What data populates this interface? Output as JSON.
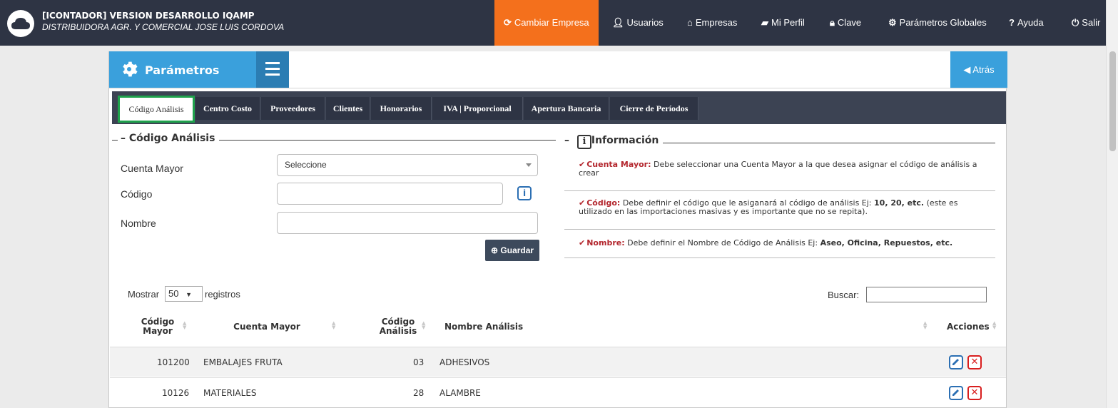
{
  "header": {
    "brand_title": "[ICONTADOR] VERSION DESARROLLO IQAMP",
    "brand_subtitle": "DISTRIBUIDORA AGR. Y COMERCIAL JOSE LUIS CORDOVA",
    "nav": [
      {
        "label": "Cambiar Empresa",
        "icon": "refresh-icon"
      },
      {
        "label": "Usuarios",
        "icon": "user-icon"
      },
      {
        "label": "Empresas",
        "icon": "home-icon"
      },
      {
        "label": "Mi Perfil",
        "icon": "folder-icon"
      },
      {
        "label": "Clave",
        "icon": "lock-icon"
      },
      {
        "label": "Parámetros Globales",
        "icon": "gear-icon"
      },
      {
        "label": "Ayuda",
        "icon": "question-icon"
      },
      {
        "label": "Salir",
        "icon": "power-icon"
      }
    ],
    "accent": "#f4701c",
    "bg": "#2e3444"
  },
  "panel": {
    "title": "Parámetros",
    "back_label": "Atrás"
  },
  "tabs": [
    "Código Análisis",
    "Centro Costo",
    "Proveedores",
    "Clientes",
    "Honorarios",
    "IVA | Proporcional",
    "Apertura Bancaria",
    "Cierre de Períodos"
  ],
  "form": {
    "legend": "Código Análisis",
    "cuenta_label": "Cuenta Mayor",
    "cuenta_value": "Seleccione",
    "codigo_label": "Código",
    "codigo_value": "",
    "nombre_label": "Nombre",
    "nombre_value": "",
    "save_label": "Guardar"
  },
  "info": {
    "legend": "Información",
    "items": [
      {
        "key": "Cuenta Mayor:",
        "text": "Debe seleccionar una Cuenta Mayor a la que desea asignar el código de análisis a crear"
      },
      {
        "key": "Código:",
        "text_a": "Debe definir el código que le asiganará al código de análisis Ej:",
        "bold": "10, 20, etc.",
        "text_b": "(este es utilizado en las importaciones masivas y es importante que no se repita)."
      },
      {
        "key": "Nombre:",
        "text_a": "Debe definir el Nombre de Código de Análisis Ej:",
        "bold": "Aseo, Oficina, Repuestos, etc."
      }
    ]
  },
  "table": {
    "show_prefix": "Mostrar",
    "show_value": "50",
    "show_suffix": "registros",
    "search_label": "Buscar:",
    "search_value": "",
    "headers": {
      "codigo_mayor_1": "Código",
      "codigo_mayor_2": "Mayor",
      "cuenta_mayor": "Cuenta Mayor",
      "codigo_analisis_1": "Código",
      "codigo_analisis_2": "Análisis",
      "nombre_analisis": "Nombre Análisis",
      "acciones": "Acciones"
    },
    "rows": [
      {
        "codigo_mayor": "101200",
        "cuenta_mayor": "EMBALAJES FRUTA",
        "codigo_analisis": "03",
        "nombre": "ADHESIVOS"
      },
      {
        "codigo_mayor": "10126",
        "cuenta_mayor": "MATERIALES",
        "codigo_analisis": "28",
        "nombre": "ALAMBRE"
      }
    ]
  }
}
